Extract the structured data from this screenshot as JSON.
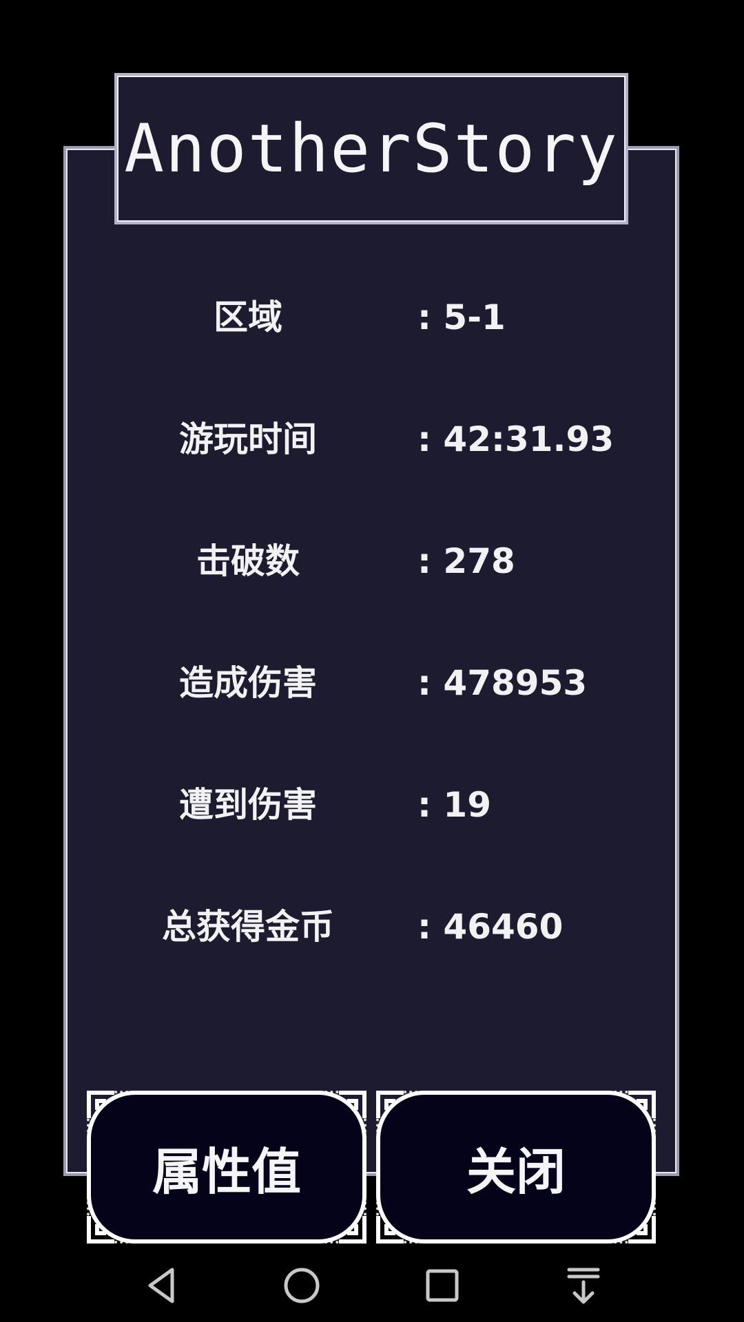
{
  "title": "AnotherStory",
  "stats": [
    {
      "label": "区域",
      "value": ": 5-1"
    },
    {
      "label": "游玩时间",
      "value": ": 42:31.93"
    },
    {
      "label": "击破数",
      "value": ": 278"
    },
    {
      "label": "造成伤害",
      "value": ": 478953"
    },
    {
      "label": "遭到伤害",
      "value": ": 19"
    },
    {
      "label": "总获得金币",
      "value": ": 46460"
    }
  ],
  "buttons": {
    "attributes": "属性值",
    "close": "关闭"
  },
  "navbar": {
    "icons": [
      "back-icon",
      "home-icon",
      "recents-icon",
      "notification-pulldown-icon"
    ]
  },
  "colors": {
    "panel_bg": "#1c1b30",
    "button_bg": "#04031a",
    "text": "#f2f2f4"
  }
}
